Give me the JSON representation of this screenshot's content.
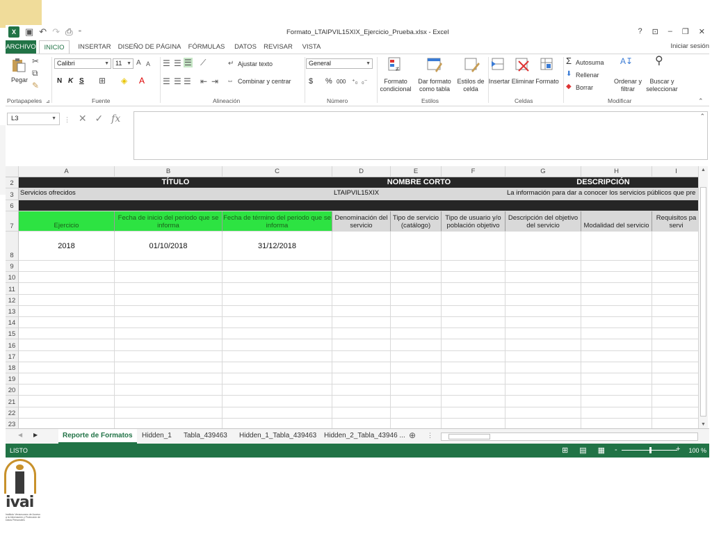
{
  "window": {
    "title": "Formato_LTAIPVIL15XIX_Ejercicio_Prueba.xlsx - Excel",
    "app_badge": "X",
    "controls": [
      "?",
      "⊡",
      "–",
      "❐",
      "✕"
    ],
    "sign_in": "Iniciar sesión"
  },
  "ribbon_tabs": [
    "ARCHIVO",
    "INICIO",
    "INSERTAR",
    "DISEÑO DE PÁGINA",
    "FÓRMULAS",
    "DATOS",
    "REVISAR",
    "VISTA"
  ],
  "ribbon": {
    "clipboard": {
      "paste": "Pegar",
      "group": "Portapapeles"
    },
    "font": {
      "name": "Calibri",
      "size": "11",
      "grow": "A",
      "shrink": "A",
      "bold": "N",
      "italic": "K",
      "underline": "S",
      "group": "Fuente"
    },
    "alignment": {
      "wrap": "Ajustar texto",
      "merge": "Combinar y centrar",
      "group": "Alineación"
    },
    "number": {
      "format": "General",
      "currency": "$",
      "percent": "%",
      "thousands": "000",
      "group": "Número"
    },
    "styles": {
      "conditional": [
        "Formato",
        "condicional"
      ],
      "as_table": [
        "Dar formato",
        "como tabla"
      ],
      "cell_styles": [
        "Estilos de",
        "celda"
      ],
      "group": "Estilos"
    },
    "cells": {
      "insert": "Insertar",
      "delete": "Eliminar",
      "format": "Formato",
      "group": "Celdas"
    },
    "editing": {
      "autosum": "Autosuma",
      "fill": "Rellenar",
      "clear": "Borrar",
      "sort": [
        "Ordenar y",
        "filtrar"
      ],
      "find": [
        "Buscar y",
        "seleccionar"
      ],
      "group": "Modificar"
    }
  },
  "formula_bar": {
    "name_box": "L3",
    "fx": "fx",
    "value": ""
  },
  "columns": [
    "A",
    "B",
    "C",
    "D",
    "E",
    "F",
    "G",
    "H",
    "I"
  ],
  "rows": {
    "r2": {
      "num": "2",
      "titulo": "TÍTULO",
      "nombre_corto": "NOMBRE CORTO",
      "descripcion": "DESCRIPCIÓN"
    },
    "r3": {
      "num": "3",
      "titulo_val": "Servicios ofrecidos",
      "nombre_corto_val": "LTAIPVIL15XIX",
      "descripcion_val": "La información para dar a conocer los servicios públicos que pre"
    },
    "r6": {
      "num": "6"
    },
    "r7": {
      "num": "7",
      "headers": [
        "Ejercicio",
        "Fecha de inicio del periodo que se informa",
        "Fecha de término del periodo que se informa",
        "Denominación del servicio",
        "Tipo de servicio (catálogo)",
        "Tipo de usuario y/o población objetivo",
        "Descripción del objetivo del servicio",
        "Modalidad del servicio",
        "Requisitos pa servi"
      ]
    },
    "r8": {
      "num": "8",
      "values": [
        "2018",
        "01/10/2018",
        "31/12/2018",
        "",
        "",
        "",
        "",
        "",
        ""
      ]
    },
    "empty": [
      "9",
      "10",
      "11",
      "12",
      "13",
      "14",
      "15",
      "16",
      "17",
      "18",
      "19",
      "20",
      "21",
      "22",
      "23"
    ]
  },
  "sheet_tabs": [
    "Reporte de Formatos",
    "Hidden_1",
    "Tabla_439463",
    "Hidden_1_Tabla_439463",
    "Hidden_2_Tabla_43946 ..."
  ],
  "status": {
    "ready": "LISTO",
    "zoom": "100 %"
  },
  "logo": {
    "word": "ivai",
    "tagline": "Instituto Veracruzano de Acceso a la Información y Protección de Datos Personales"
  },
  "colors": {
    "excel_green": "#217346",
    "header_green": "#2de342",
    "dark_header": "#262626",
    "gray_cell": "#d9d9d9"
  }
}
